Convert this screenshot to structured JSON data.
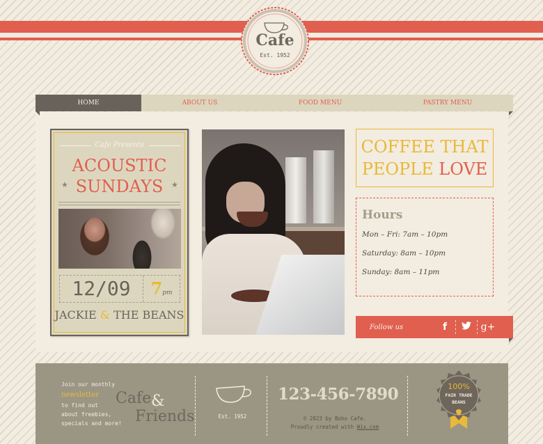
{
  "logo": {
    "title": "Cafe",
    "est": "Est. 1952",
    "icon": "coffee-cup-icon"
  },
  "nav": {
    "items": [
      {
        "label": "HOME",
        "active": true
      },
      {
        "label": "ABOUT US",
        "active": false
      },
      {
        "label": "FOOD MENU",
        "active": false
      },
      {
        "label": "PASTRY MENU",
        "active": false
      }
    ]
  },
  "poster": {
    "presents": "Cafe Presents",
    "title_line1": "ACOUSTIC",
    "title_line2": "SUNDAYS",
    "star": "★",
    "date": "12/09",
    "time": "7",
    "time_suffix": "pm",
    "band_part1": "JACKIE ",
    "band_amp": "&",
    "band_part2": " THE BEANS"
  },
  "headline": {
    "line1": "COFFEE THAT",
    "line2_prefix": "PEOPLE ",
    "line2_accent": "LOVE"
  },
  "hours": {
    "title": "Hours",
    "rows": [
      "Mon – Fri: 7am – 10pm",
      "Saturday: 8am – 10pm",
      "Sunday: 8am – 11pm"
    ]
  },
  "follow": {
    "label": "Follow us",
    "icons": [
      {
        "name": "facebook-icon",
        "glyph": "f"
      },
      {
        "name": "twitter-icon",
        "glyph": "🐦"
      },
      {
        "name": "google-plus-icon",
        "glyph": "g+"
      }
    ]
  },
  "footer": {
    "newsletter_pre": "Join our monthly",
    "newsletter_link": "newsletter",
    "newsletter_post1": "to find out",
    "newsletter_post2": "about freebies,",
    "newsletter_post3": "specials and more!",
    "brand_cafe": "Cafe",
    "brand_amp": "&",
    "brand_friends": "Friends",
    "est": "Est. 1952",
    "phone": "123-456-7890",
    "copyright": "© 2023 by Boho Cafe.",
    "created_pre": "Proudly created with ",
    "created_link": "Wix.com",
    "badge_pct": "100%",
    "badge_line1": "FAIR TRADE",
    "badge_line2": "BEANS"
  },
  "colors": {
    "accent_red": "#e05f4e",
    "accent_gold": "#e8b93a",
    "dark_taupe": "#67635a",
    "footer_bg": "#9b9684",
    "cream": "#f3ece0"
  }
}
